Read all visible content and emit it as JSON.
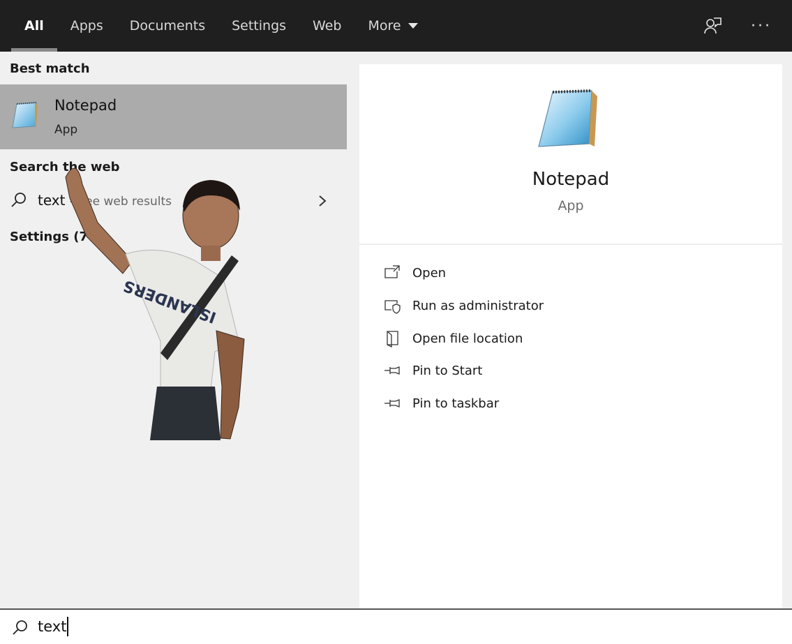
{
  "tabs": [
    {
      "label": "All",
      "active": true
    },
    {
      "label": "Apps",
      "active": false
    },
    {
      "label": "Documents",
      "active": false
    },
    {
      "label": "Settings",
      "active": false
    },
    {
      "label": "Web",
      "active": false
    },
    {
      "label": "More",
      "active": false
    }
  ],
  "top_icons": {
    "feedback": "feedback-icon",
    "more": "···"
  },
  "results": {
    "best_match_header": "Best match",
    "best_match": {
      "title": "Notepad",
      "subtitle": "App",
      "icon": "notepad-icon"
    },
    "search_web_header": "Search the web",
    "web_result": {
      "query": "text",
      "hint": "- See web results"
    },
    "settings_header": "Settings (7+)"
  },
  "preview": {
    "title": "Notepad",
    "type": "App",
    "actions": [
      {
        "label": "Open",
        "icon": "open-icon"
      },
      {
        "label": "Run as administrator",
        "icon": "run-as-admin-icon"
      },
      {
        "label": "Open file location",
        "icon": "file-location-icon"
      },
      {
        "label": "Pin to Start",
        "icon": "pin-icon"
      },
      {
        "label": "Pin to taskbar",
        "icon": "pin-icon"
      }
    ]
  },
  "search": {
    "value": "text",
    "icon": "search-icon"
  },
  "colors": {
    "topbar": "#1f1f1f",
    "selected_row": "#ababab",
    "pane": "#f0f0f0"
  }
}
